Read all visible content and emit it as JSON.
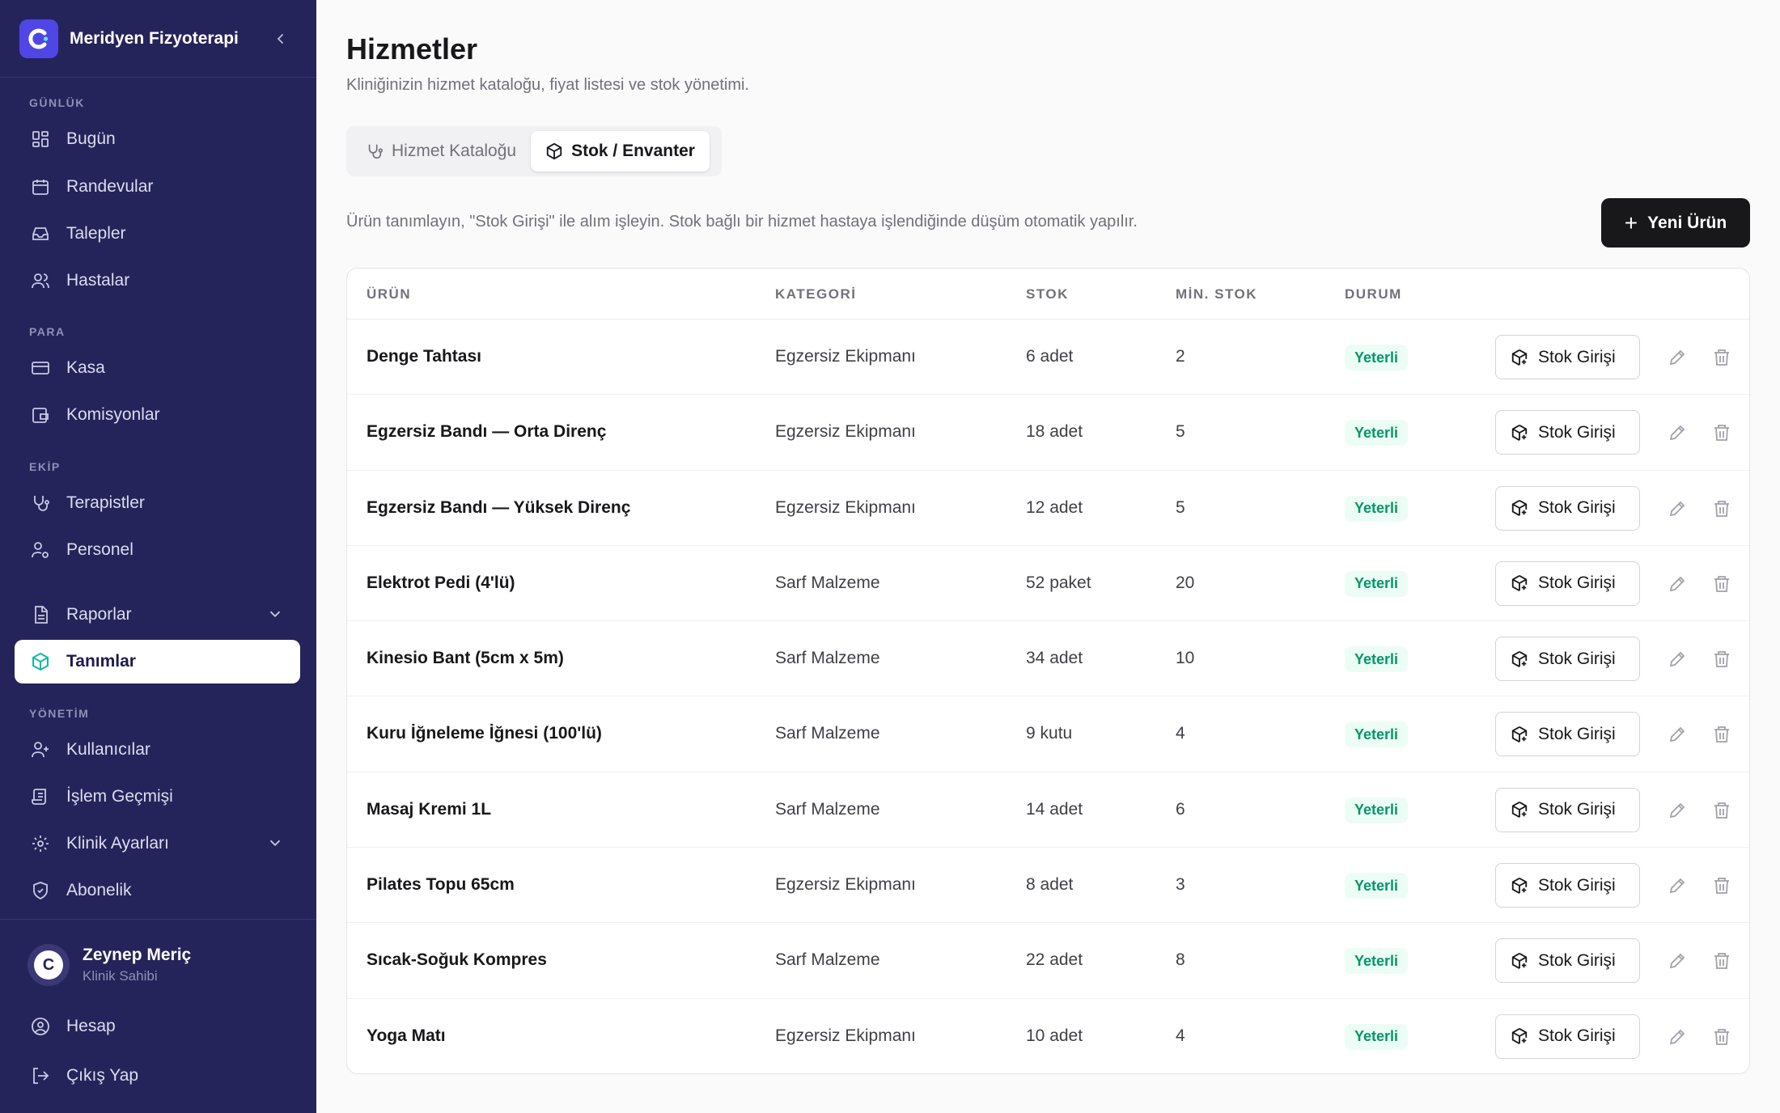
{
  "brand": {
    "name": "Meridyen Fizyoterapi"
  },
  "sidebar": {
    "sections": {
      "gunluk": "GÜNLÜK",
      "para": "PARA",
      "ekip": "EKİP",
      "yonetim": "YÖNETİM"
    },
    "items": {
      "bugun": "Bugün",
      "randevular": "Randevular",
      "talepler": "Talepler",
      "hastalar": "Hastalar",
      "kasa": "Kasa",
      "komisyonlar": "Komisyonlar",
      "terapistler": "Terapistler",
      "personel": "Personel",
      "raporlar": "Raporlar",
      "tanimlar": "Tanımlar",
      "kullanicilar": "Kullanıcılar",
      "islem_gecmisi": "İşlem Geçmişi",
      "klinik_ayarlari": "Klinik Ayarları",
      "abonelik": "Abonelik",
      "hesap": "Hesap",
      "cikis": "Çıkış Yap"
    },
    "active_item": "tanimlar",
    "user": {
      "name": "Zeynep Meriç",
      "role": "Klinik Sahibi",
      "avatar_letter": "C"
    }
  },
  "page": {
    "title": "Hizmetler",
    "subtitle": "Kliniğinizin hizmet kataloğu, fiyat listesi ve stok yönetimi.",
    "tabs": [
      {
        "label": "Hizmet Kataloğu",
        "active": false
      },
      {
        "label": "Stok / Envanter",
        "active": true
      }
    ],
    "hint": "Ürün tanımlayın, \"Stok Girişi\" ile alım işleyin. Stok bağlı bir hizmet hastaya işlendiğinde düşüm otomatik yapılır.",
    "new_button": "Yeni Ürün"
  },
  "table": {
    "headers": {
      "name": "ÜRÜN",
      "category": "KATEGORİ",
      "stock": "STOK",
      "min_stock": "MİN. STOK",
      "status": "DURUM"
    },
    "stock_button_label": "Stok Girişi",
    "rows": [
      {
        "name": "Denge Tahtası",
        "category": "Egzersiz Ekipmanı",
        "stock": "6 adet",
        "min_stock": "2",
        "status": "Yeterli"
      },
      {
        "name": "Egzersiz Bandı — Orta Direnç",
        "category": "Egzersiz Ekipmanı",
        "stock": "18 adet",
        "min_stock": "5",
        "status": "Yeterli"
      },
      {
        "name": "Egzersiz Bandı — Yüksek Direnç",
        "category": "Egzersiz Ekipmanı",
        "stock": "12 adet",
        "min_stock": "5",
        "status": "Yeterli"
      },
      {
        "name": "Elektrot Pedi (4'lü)",
        "category": "Sarf Malzeme",
        "stock": "52 paket",
        "min_stock": "20",
        "status": "Yeterli"
      },
      {
        "name": "Kinesio Bant (5cm x 5m)",
        "category": "Sarf Malzeme",
        "stock": "34 adet",
        "min_stock": "10",
        "status": "Yeterli"
      },
      {
        "name": "Kuru İğneleme İğnesi (100'lü)",
        "category": "Sarf Malzeme",
        "stock": "9 kutu",
        "min_stock": "4",
        "status": "Yeterli"
      },
      {
        "name": "Masaj Kremi 1L",
        "category": "Sarf Malzeme",
        "stock": "14 adet",
        "min_stock": "6",
        "status": "Yeterli"
      },
      {
        "name": "Pilates Topu 65cm",
        "category": "Egzersiz Ekipmanı",
        "stock": "8 adet",
        "min_stock": "3",
        "status": "Yeterli"
      },
      {
        "name": "Sıcak-Soğuk Kompres",
        "category": "Sarf Malzeme",
        "stock": "22 adet",
        "min_stock": "8",
        "status": "Yeterli"
      },
      {
        "name": "Yoga Matı",
        "category": "Egzersiz Ekipmanı",
        "stock": "10 adet",
        "min_stock": "4",
        "status": "Yeterli"
      }
    ]
  },
  "colors": {
    "sidebar": "#25245a",
    "accent": "#4f46e5",
    "success": "#059669",
    "primary_button": "#18181b"
  }
}
